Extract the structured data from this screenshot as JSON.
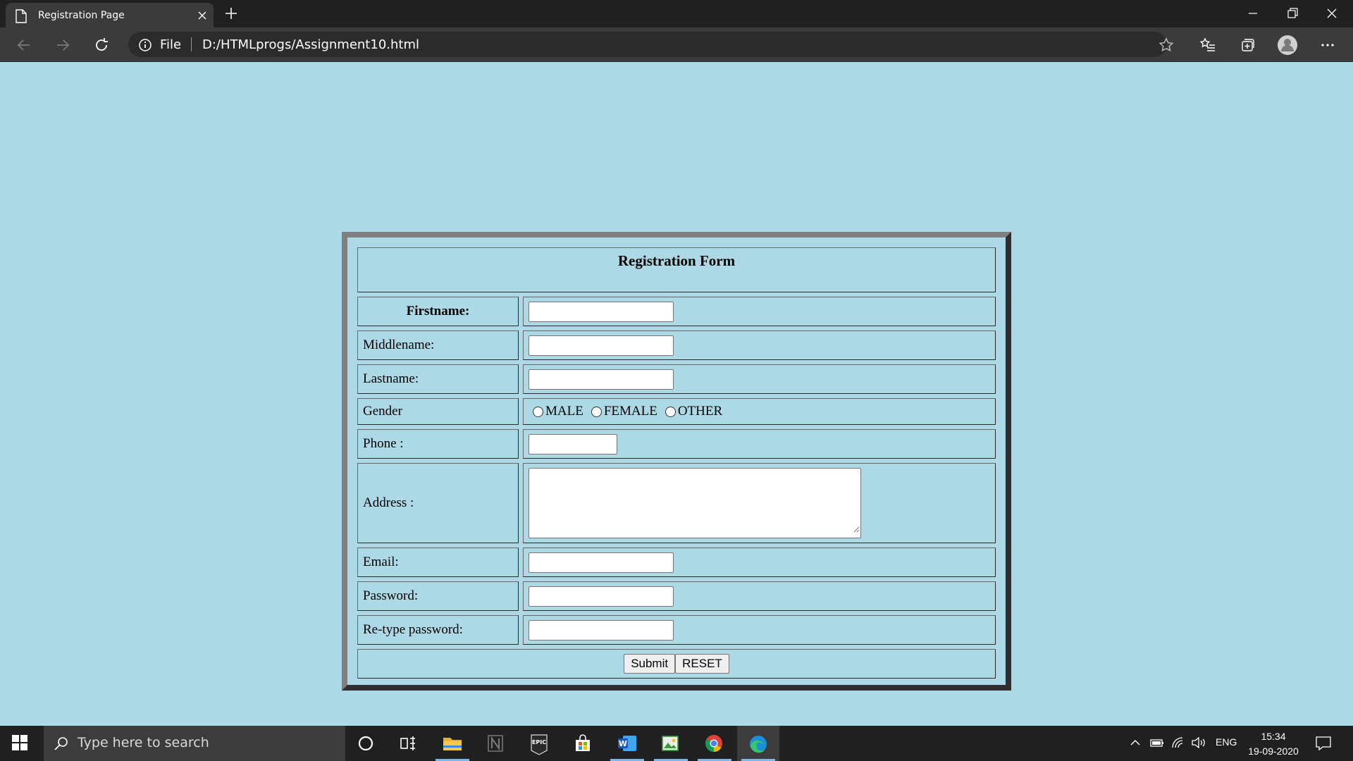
{
  "browser": {
    "tab_title": "Registration Page",
    "scheme_label": "File",
    "url": "D:/HTMLprogs/Assignment10.html"
  },
  "form": {
    "title": "Registration Form",
    "labels": {
      "firstname": "Firstname:",
      "middlename": "Middlename:",
      "lastname": "Lastname:",
      "gender": "Gender",
      "phone": "Phone :",
      "address": "Address :",
      "email": "Email:",
      "password": "Password:",
      "retype_password": "Re-type password:"
    },
    "gender_options": [
      "MALE",
      "FEMALE",
      "OTHER"
    ],
    "buttons": {
      "submit": "Submit",
      "reset": "RESET"
    }
  },
  "taskbar": {
    "search_placeholder": "Type here to search",
    "language": "ENG",
    "time": "15:34",
    "date": "19-09-2020"
  },
  "colors": {
    "page_background": "#add8e6",
    "browser_dark": "#202020",
    "running_indicator": "#76b9ed"
  }
}
